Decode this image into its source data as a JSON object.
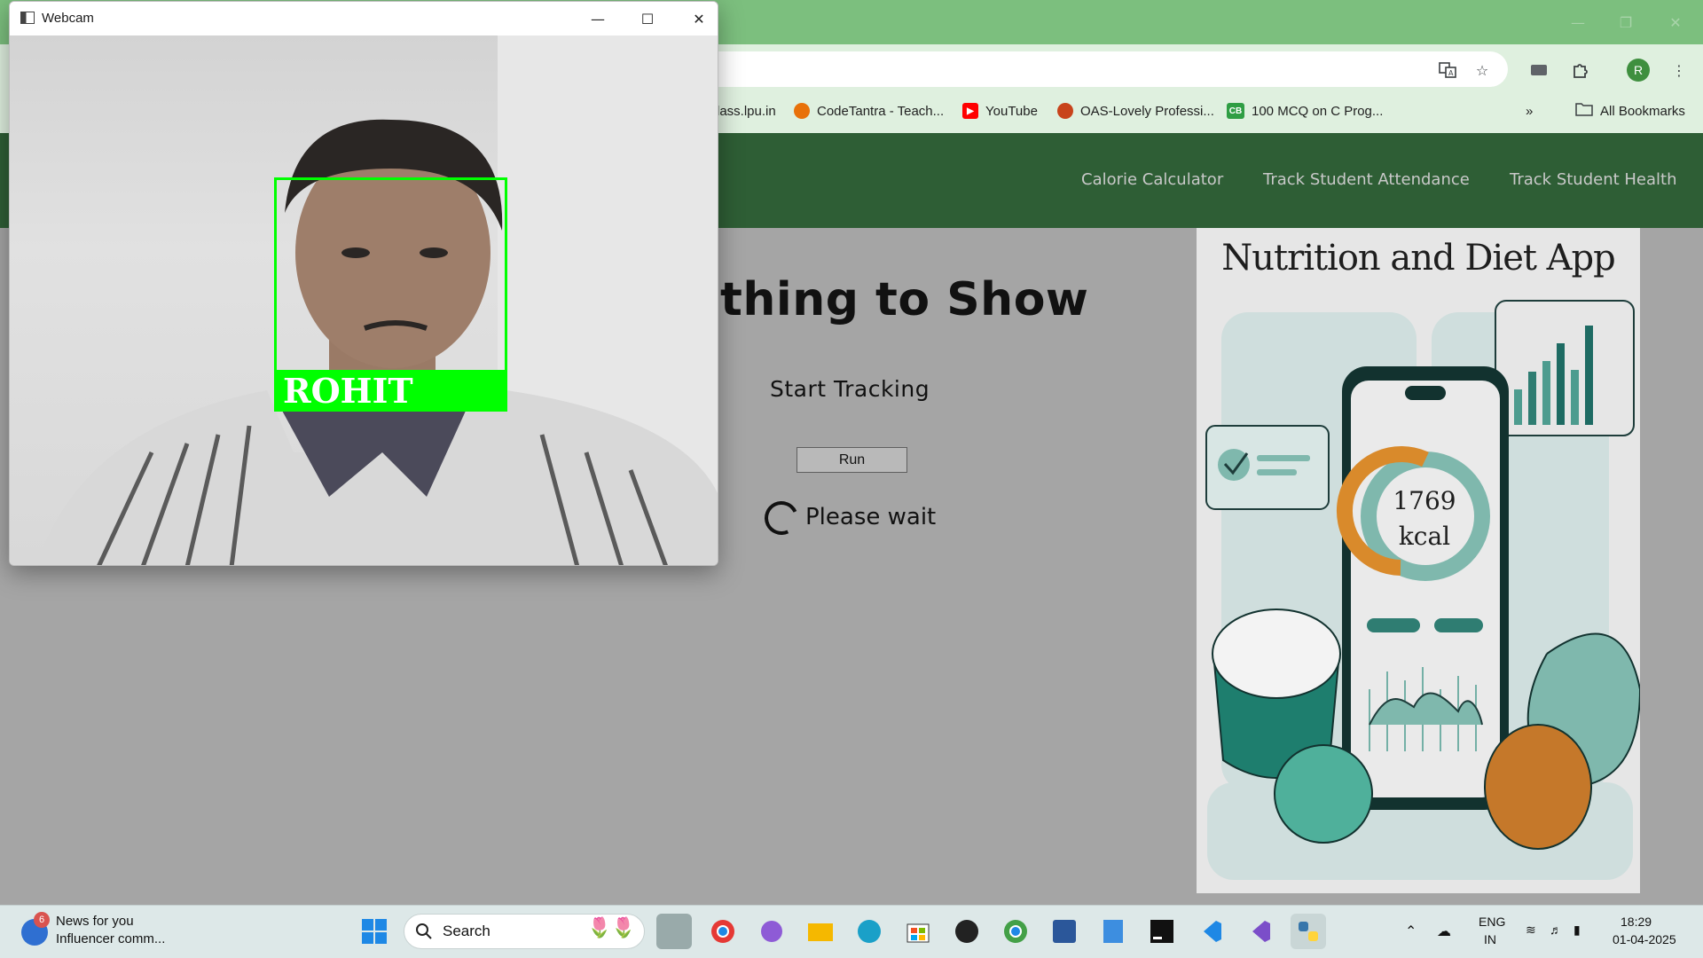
{
  "browser": {
    "bookmarks": [
      {
        "label": "lass.lpu.in",
        "icon_color": "#ffffff"
      },
      {
        "label": "CodeTantra - Teach...",
        "icon_color": "#e8710a"
      },
      {
        "label": "YouTube",
        "icon_color": "#ff0000"
      },
      {
        "label": "OAS-Lovely Professi...",
        "icon_color": "#c8431b"
      },
      {
        "label": "100 MCQ on C Prog...",
        "icon_color": "#2f9e44",
        "icon_text": "CB"
      }
    ],
    "all_bookmarks_label": "All Bookmarks",
    "profile_initial": "R"
  },
  "page": {
    "nav": [
      "Calorie Calculator",
      "Track Student Attendance",
      "Track Student Health"
    ],
    "heading": "thing to Show",
    "subheading": "Start Tracking",
    "run_label": "Run",
    "wait_text": "Please wait",
    "illustration": {
      "title": "Nutrition and Diet App",
      "kcal_value": "1769",
      "kcal_unit": "kcal"
    }
  },
  "webcam": {
    "title": "Webcam",
    "detected_name": "ROHIT"
  },
  "taskbar": {
    "news_title": "News for you",
    "news_sub": "Influencer comm...",
    "news_badge": "6",
    "search_placeholder": "Search",
    "lang_top": "ENG",
    "lang_bottom": "IN",
    "time": "18:29",
    "date": "01-04-2025"
  },
  "colors": {
    "frame": "#7cbf7e",
    "nav": "#2e5e35",
    "face_box": "#00ff00"
  }
}
